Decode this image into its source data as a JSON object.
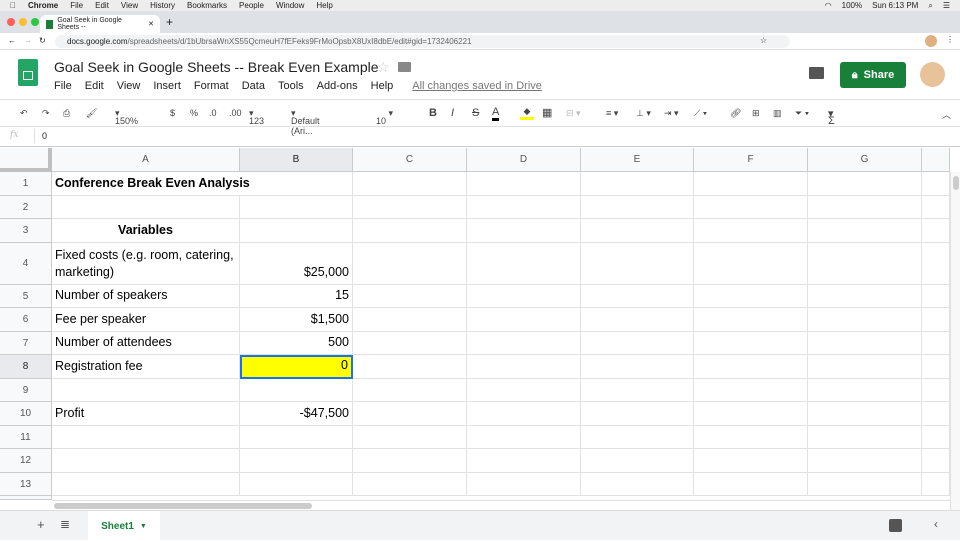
{
  "os_menu": {
    "app": "Chrome",
    "items": [
      "File",
      "Edit",
      "View",
      "History",
      "Bookmarks",
      "People",
      "Window",
      "Help"
    ],
    "battery": "100%",
    "clock": "Sun 6:13 PM"
  },
  "browser": {
    "tab_title": "Goal Seek in Google Sheets --",
    "url_host": "docs.google.com",
    "url_path": "/spreadsheets/d/1bUbrsaWnXS55QcmeuH7fEFeks9FrMoOpsbX8UxI8dbE/edit#gid=1732406221"
  },
  "doc": {
    "title": "Goal Seek in Google Sheets -- Break Even Example",
    "menu": [
      "File",
      "Edit",
      "View",
      "Insert",
      "Format",
      "Data",
      "Tools",
      "Add-ons",
      "Help"
    ],
    "save_status": "All changes saved in Drive",
    "share_label": "Share"
  },
  "toolbar": {
    "zoom": "150%",
    "currency": "$",
    "percent": "%",
    "dec_less": ".0",
    "dec_more": ".00",
    "more_formats": "123",
    "font": "Default (Ari...",
    "font_size": "10",
    "bold": "B",
    "italic": "I",
    "strike": "S",
    "text_color": "A",
    "sum": "Σ"
  },
  "formula_bar": {
    "label": "fx",
    "value": "0"
  },
  "columns": [
    "A",
    "B",
    "C",
    "D",
    "E",
    "F",
    "G"
  ],
  "rows": [
    {
      "n": "1",
      "a": "Conference Break Even Analysis",
      "b": ""
    },
    {
      "n": "2",
      "a": "",
      "b": ""
    },
    {
      "n": "3",
      "a": "Variables",
      "b": ""
    },
    {
      "n": "4",
      "a": "Fixed costs (e.g. room, catering, marketing)",
      "b": "$25,000"
    },
    {
      "n": "5",
      "a": "Number of speakers",
      "b": "15"
    },
    {
      "n": "6",
      "a": "Fee per speaker",
      "b": "$1,500"
    },
    {
      "n": "7",
      "a": "Number of attendees",
      "b": "500"
    },
    {
      "n": "8",
      "a": "Registration fee",
      "b": "0"
    },
    {
      "n": "9",
      "a": "",
      "b": ""
    },
    {
      "n": "10",
      "a": "Profit",
      "b": "-$47,500"
    },
    {
      "n": "11",
      "a": "",
      "b": ""
    },
    {
      "n": "12",
      "a": "",
      "b": ""
    },
    {
      "n": "13",
      "a": "",
      "b": ""
    }
  ],
  "sheet_tab": "Sheet1",
  "colors": {
    "green": "#188038",
    "highlight": "#ffff00",
    "selection": "#1a73e8"
  }
}
